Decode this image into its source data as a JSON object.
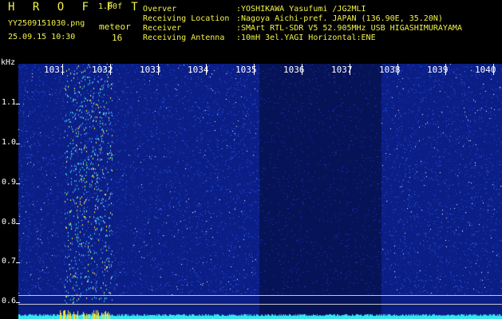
{
  "header": {
    "app_title": "H R O F F T",
    "version": "1.00f",
    "filename": "YY2509151030.png",
    "meteor_label": "meteor",
    "datetime": "25.09.15 10:30",
    "meteor_count": "16"
  },
  "info": [
    {
      "label": "Overver",
      "value": ":YOSHIKAWA Yasufumi /JG2MLI"
    },
    {
      "label": "Receiving Location",
      "value": ":Nagoya Aichi-pref. JAPAN (136.90E, 35.20N)"
    },
    {
      "label": "Receiver",
      "value": ":SMArt RTL-SDR V5 52.905MHz USB HIGASHIMURAYAMA"
    },
    {
      "label": "Receiving Antenna",
      "value": ":10mH 3el.YAGI Horizontal:ENE"
    }
  ],
  "spectrogram": {
    "y_unit": "kHz",
    "y_ticks": [
      "1.1",
      "1.0",
      "0.9",
      "0.8",
      "0.7",
      "0.6"
    ],
    "x_ticks": [
      "1031",
      "1032",
      "1033",
      "1034",
      "1035",
      "1036",
      "1037",
      "1038",
      "1039",
      "1040"
    ],
    "colors": {
      "background": "#0b1e86",
      "noise_low": "#1a3cc8",
      "noise_high": "#ffffff",
      "echo": "#f2e640",
      "level": "#38e6ee"
    }
  }
}
